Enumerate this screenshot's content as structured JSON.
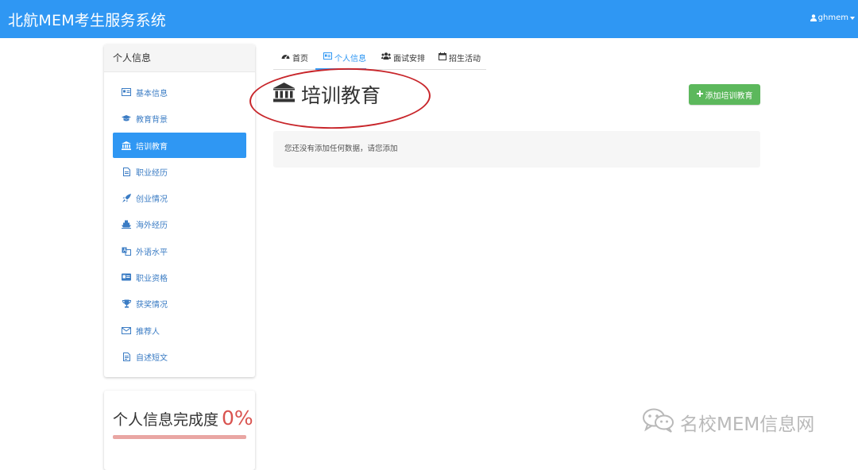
{
  "navbar": {
    "brand": "北航MEM考生服务系统",
    "user": "ghmem"
  },
  "sidebar": {
    "title": "个人信息",
    "items": [
      {
        "label": "基本信息",
        "icon": "id-card-icon"
      },
      {
        "label": "教育背景",
        "icon": "graduation-cap-icon"
      },
      {
        "label": "培训教育",
        "icon": "bank-icon",
        "active": true
      },
      {
        "label": "职业经历",
        "icon": "file-icon"
      },
      {
        "label": "创业情况",
        "icon": "rocket-icon"
      },
      {
        "label": "海外经历",
        "icon": "ship-icon"
      },
      {
        "label": "外语水平",
        "icon": "language-icon"
      },
      {
        "label": "职业资格",
        "icon": "credit-card-icon"
      },
      {
        "label": "获奖情况",
        "icon": "trophy-icon"
      },
      {
        "label": "推荐人",
        "icon": "envelope-icon"
      },
      {
        "label": "自述短文",
        "icon": "document-icon"
      }
    ],
    "progress": {
      "label": "个人信息完成度",
      "value": "0%"
    }
  },
  "tabs": [
    {
      "label": "首页",
      "icon": "dashboard-icon"
    },
    {
      "label": "个人信息",
      "icon": "id-card-icon",
      "active": true
    },
    {
      "label": "面试安排",
      "icon": "users-icon"
    },
    {
      "label": "招生活动",
      "icon": "calendar-icon"
    }
  ],
  "main": {
    "heading": "培训教育",
    "add_button": "添加培训教育",
    "empty_message": "您还没有添加任何数据，请您添加"
  },
  "watermark": "名校MEM信息网",
  "colors": {
    "primary": "#2f97f3",
    "success": "#5cb85c",
    "danger": "#d9534f",
    "annotation": "#c8262b"
  }
}
